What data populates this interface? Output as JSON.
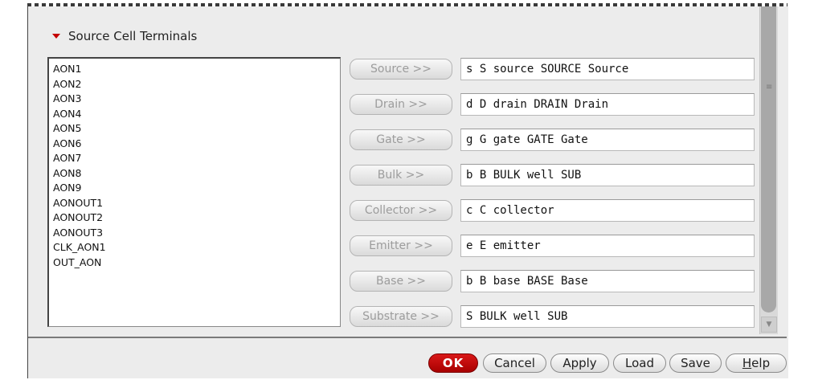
{
  "section": {
    "title": "Source Cell Terminals"
  },
  "terminal_list": [
    "AON1",
    "AON2",
    "AON3",
    "AON4",
    "AON5",
    "AON6",
    "AON7",
    "AON8",
    "AON9",
    "AONOUT1",
    "AONOUT2",
    "AONOUT3",
    "CLK_AON1",
    "OUT_AON"
  ],
  "terminals": [
    {
      "button": "Source >>",
      "value": "s S source SOURCE Source"
    },
    {
      "button": "Drain >>",
      "value": "d D drain DRAIN Drain"
    },
    {
      "button": "Gate >>",
      "value": "g G gate GATE Gate"
    },
    {
      "button": "Bulk >>",
      "value": "b B BULK well SUB"
    },
    {
      "button": "Collector >>",
      "value": "c C collector"
    },
    {
      "button": "Emitter >>",
      "value": "e E emitter"
    },
    {
      "button": "Base >>",
      "value": "b B base BASE Base"
    },
    {
      "button": "Substrate >>",
      "value": "S BULK well SUB"
    }
  ],
  "buttons": {
    "ok": "OK",
    "cancel": "Cancel",
    "apply": "Apply",
    "load": "Load",
    "save": "Save",
    "help_h": "H",
    "help_rest": "elp"
  },
  "colors": {
    "accent": "#c40000",
    "disabled_text": "#9c9c9c"
  },
  "icons": {
    "collapse": "collapse-triangle-icon",
    "scroll_down": "scroll-down-arrow-icon",
    "grip": "scroll-grip-icon"
  }
}
